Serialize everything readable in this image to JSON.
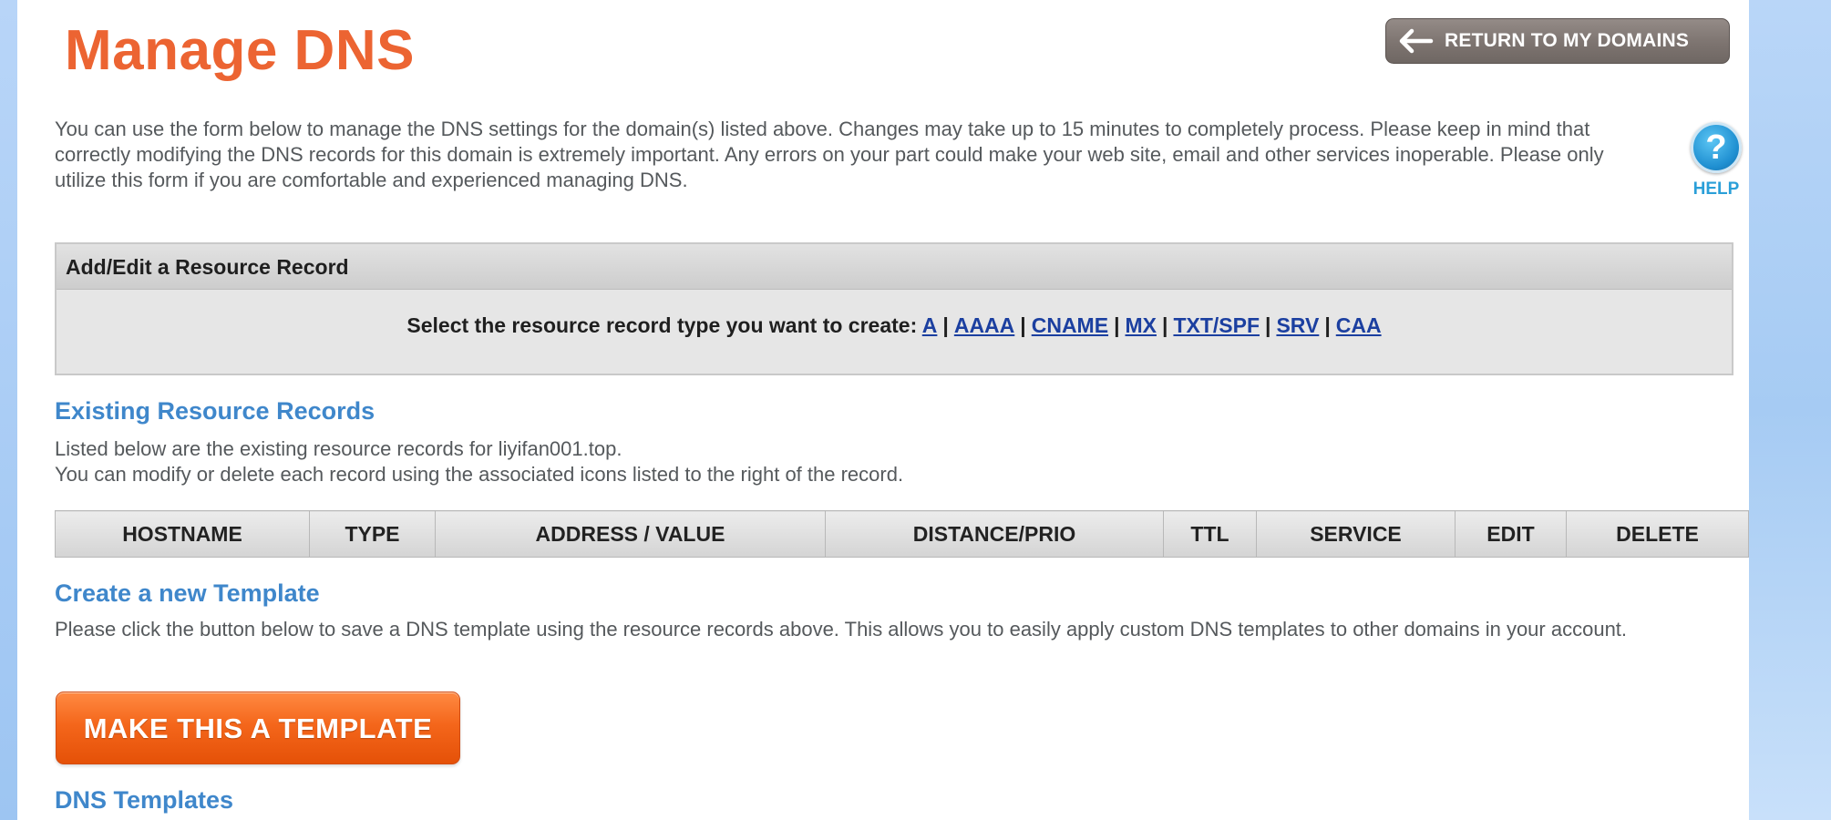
{
  "page": {
    "title": "Manage DNS",
    "return_button_label": "RETURN TO MY DOMAINS",
    "intro_text": "You can use the form below to manage the DNS settings for the domain(s) listed above. Changes may take up to 15 minutes to completely process. Please keep in mind that correctly modifying the DNS records for this domain is extremely important. Any errors on your part could make your web site, email and other services inoperable. Please only utilize this form if you are comfortable and experienced managing DNS.",
    "help": {
      "icon": "?",
      "label": "HELP"
    }
  },
  "resource_record": {
    "heading": "Add/Edit a Resource Record",
    "prompt": "Select the resource record type you want to create:",
    "types": [
      "A",
      "AAAA",
      "CNAME",
      "MX",
      "TXT/SPF",
      "SRV",
      "CAA"
    ]
  },
  "existing": {
    "heading": "Existing Resource Records",
    "line1": "Listed below are the existing resource records for liyifan001.top.",
    "line2": "You can modify or delete each record using the associated icons listed to the right of the record.",
    "columns": [
      "HOSTNAME",
      "TYPE",
      "ADDRESS / VALUE",
      "DISTANCE/PRIO",
      "TTL",
      "SERVICE",
      "EDIT",
      "DELETE"
    ]
  },
  "template": {
    "heading": "Create a new Template",
    "text": "Please click the button below to save a DNS template using the resource records above. This allows you to easily apply custom DNS templates to other domains in your account.",
    "button_label": "MAKE THIS A TEMPLATE"
  },
  "dns_templates": {
    "heading": "DNS Templates"
  },
  "colors": {
    "title": "#ec6432",
    "section_heading": "#3f87cb",
    "link": "#1b3fa0",
    "template_button": "#f4661b",
    "return_button": "#7d7470"
  }
}
